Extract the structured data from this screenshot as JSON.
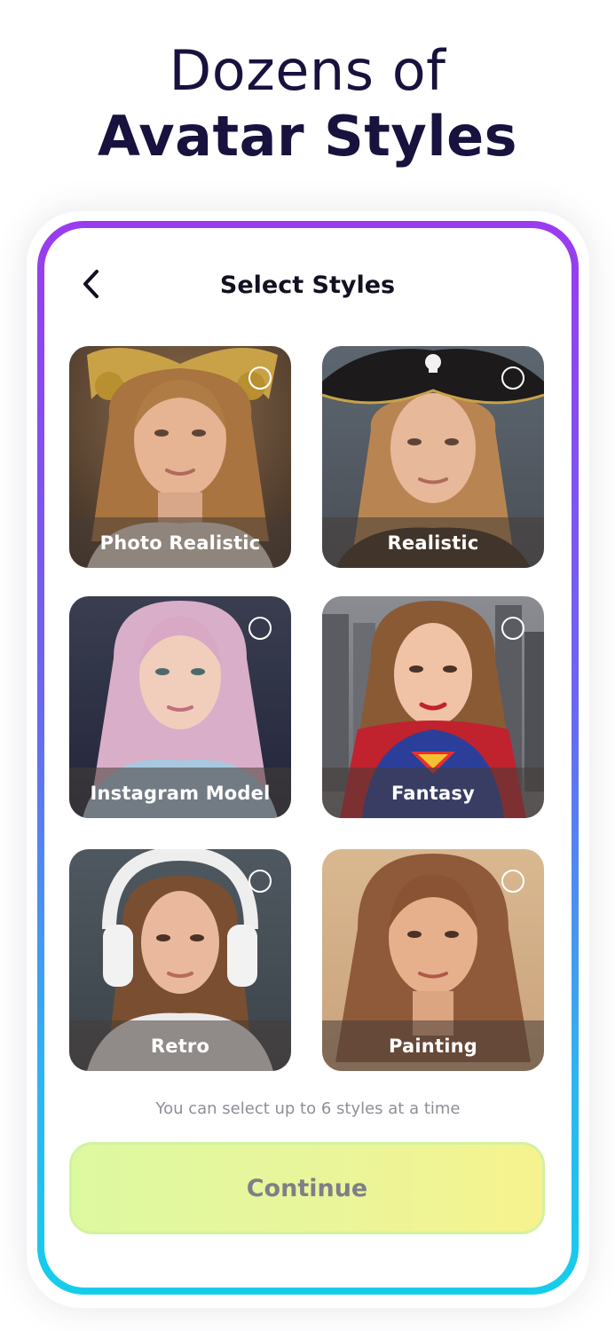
{
  "headline": {
    "line1": "Dozens of",
    "line2": "Avatar Styles"
  },
  "screen": {
    "title": "Select Styles",
    "back_icon": "chevron-left-icon",
    "styles": [
      {
        "label": "Photo Realistic",
        "selected": false,
        "theme": "golden-headdress"
      },
      {
        "label": "Realistic",
        "selected": false,
        "theme": "pirate-hat"
      },
      {
        "label": "Instagram Model",
        "selected": false,
        "theme": "pink-hair"
      },
      {
        "label": "Fantasy",
        "selected": false,
        "theme": "superhero-city"
      },
      {
        "label": "Retro",
        "selected": false,
        "theme": "headphones"
      },
      {
        "label": "Painting",
        "selected": false,
        "theme": "warm-painting"
      }
    ],
    "hint": "You can select up to 6 styles at a time",
    "continue_label": "Continue"
  },
  "colors": {
    "headline": "#17123e",
    "frame_top": "#9a3bf0",
    "frame_bottom": "#16cdea",
    "button_gradient_start": "#ddf9a0",
    "button_gradient_end": "#f6f38e",
    "button_text": "#7f7f86"
  }
}
